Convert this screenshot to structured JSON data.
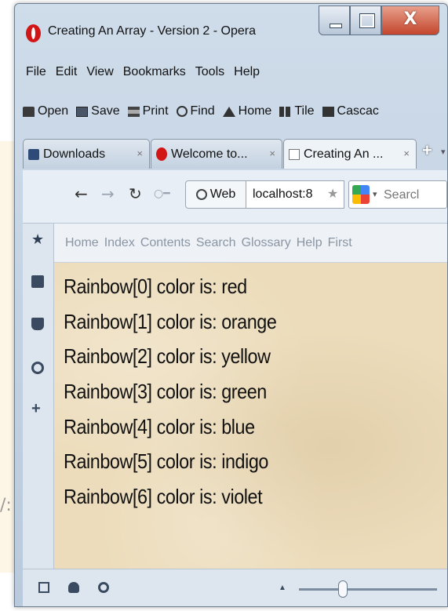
{
  "window": {
    "title": "Creating An Array - Version 2 - Opera"
  },
  "window_controls": {
    "minimize": "_",
    "maximize": "□",
    "close": "X"
  },
  "menu": [
    "File",
    "Edit",
    "View",
    "Bookmarks",
    "Tools",
    "Help"
  ],
  "toolbar": [
    {
      "label": "Open",
      "icon": "folder-icon"
    },
    {
      "label": "Save",
      "icon": "save-icon"
    },
    {
      "label": "Print",
      "icon": "print-icon"
    },
    {
      "label": "Find",
      "icon": "find-icon"
    },
    {
      "label": "Home",
      "icon": "home-icon"
    },
    {
      "label": "Tile",
      "icon": "tile-icon"
    },
    {
      "label": "Cascac",
      "icon": "cascade-icon"
    }
  ],
  "tabs": [
    {
      "label": "Downloads",
      "close": "×"
    },
    {
      "label": "Welcome to...",
      "close": "×"
    },
    {
      "label": "Creating An ...",
      "close": "×"
    }
  ],
  "newtab": "+",
  "nav": {
    "back": "←",
    "forward": "→",
    "reload": "↻",
    "key": "○━",
    "web_label": "Web",
    "url": "localhost:8",
    "star": "★",
    "search_placeholder": "Searcl",
    "search_caret": "▾"
  },
  "sidebar": {
    "star": "★",
    "plus": "+"
  },
  "links": [
    "Home",
    "Index",
    "Contents",
    "Search",
    "Glossary",
    "Help",
    "First"
  ],
  "content": {
    "lines": [
      "Rainbow[0] color is: red",
      "Rainbow[1] color is: orange",
      "Rainbow[2] color is: yellow",
      "Rainbow[3] color is: green",
      "Rainbow[4] color is: blue",
      "Rainbow[5] color is: indigo",
      "Rainbow[6] color is: violet"
    ]
  },
  "status": {
    "arrow": "▲"
  },
  "colors": {
    "opera_red": "#d21616",
    "content_bg": "#ecdcbb",
    "chrome": "#c8d6e5"
  },
  "backdrop": {
    "fragment": "/:"
  }
}
